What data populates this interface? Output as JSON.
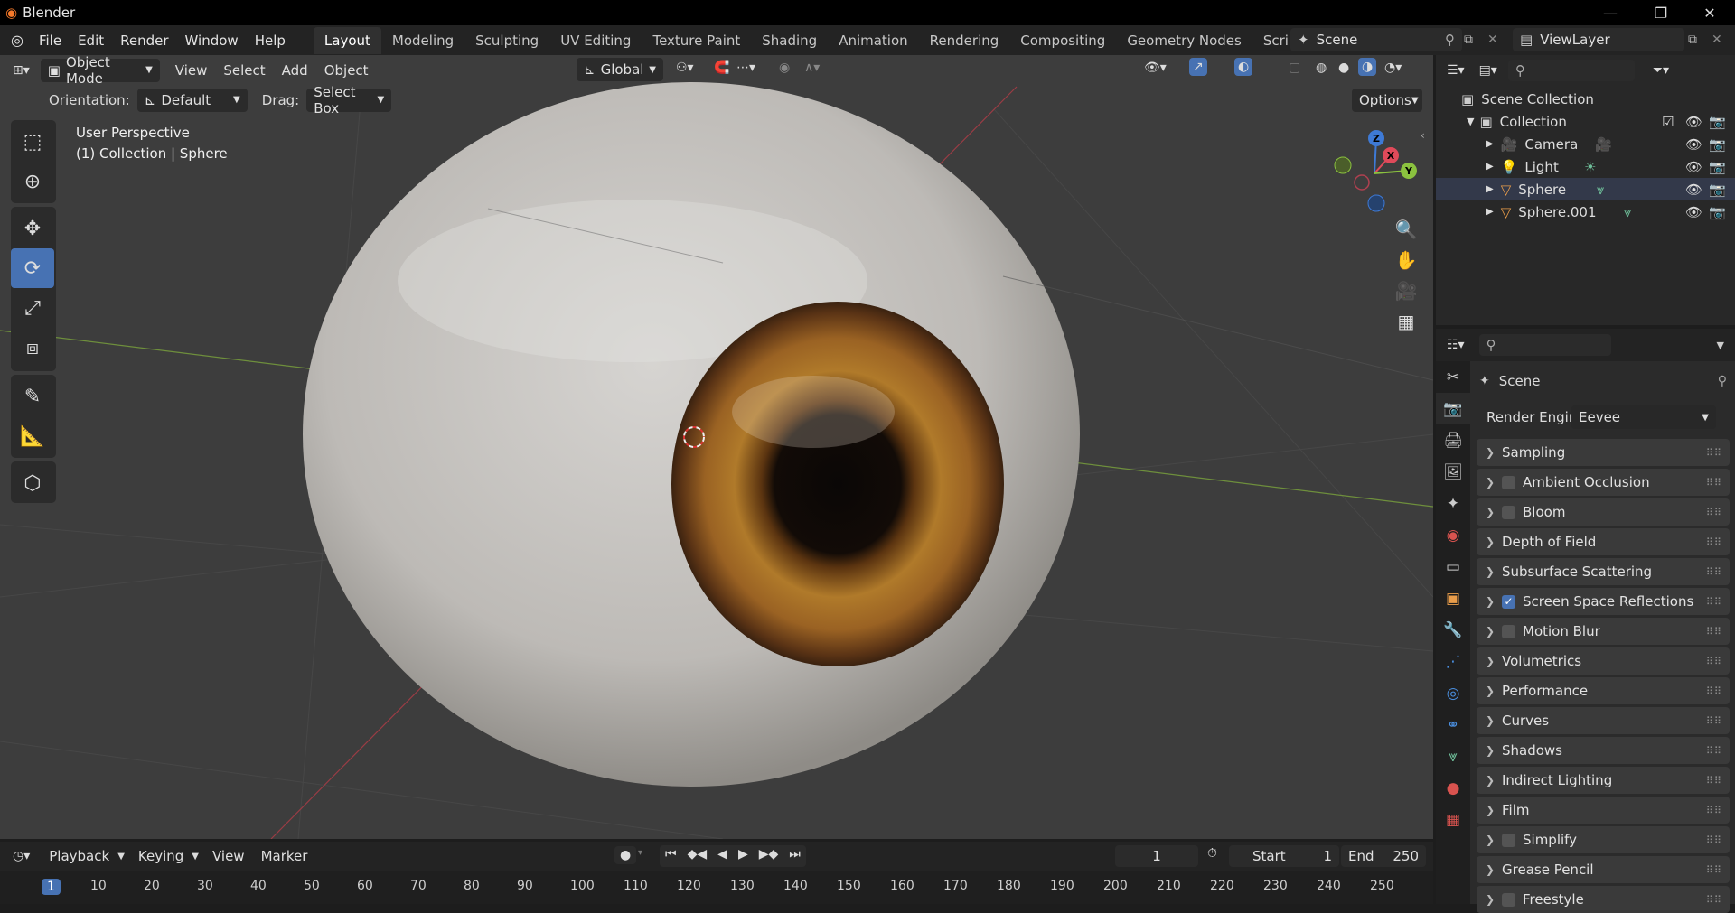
{
  "app": {
    "title": "Blender"
  },
  "menubar": {
    "items": [
      "File",
      "Edit",
      "Render",
      "Window",
      "Help"
    ]
  },
  "workspaces": {
    "tabs": [
      "Layout",
      "Modeling",
      "Sculpting",
      "UV Editing",
      "Texture Paint",
      "Shading",
      "Animation",
      "Rendering",
      "Compositing",
      "Geometry Nodes",
      "Scripting"
    ],
    "active": "Layout",
    "add_symbol": "+"
  },
  "scene": {
    "name": "Scene"
  },
  "view_layer": {
    "name": "ViewLayer"
  },
  "viewport": {
    "mode": "Object Mode",
    "menus": [
      "View",
      "Select",
      "Add",
      "Object"
    ],
    "transform_orientation": "Global",
    "orientation_label": "Orientation:",
    "orientation_value": "Default",
    "drag_label": "Drag:",
    "drag_value": "Select Box",
    "options_label": "Options",
    "overlay_text_line1": "User Perspective",
    "overlay_text_line2": "(1) Collection | Sphere",
    "gizmo_axes": {
      "x": "X",
      "y": "Y",
      "z": "Z"
    }
  },
  "outliner": {
    "root": "Scene Collection",
    "collection": "Collection",
    "items": [
      {
        "name": "Camera",
        "icon": "camera-icon"
      },
      {
        "name": "Light",
        "icon": "light-icon"
      },
      {
        "name": "Sphere",
        "icon": "mesh-icon"
      },
      {
        "name": "Sphere.001",
        "icon": "mesh-icon"
      }
    ]
  },
  "properties": {
    "context": "Scene",
    "render_engine_label": "Render Engine",
    "render_engine_value": "Eevee",
    "panels": [
      {
        "label": "Sampling",
        "checkbox": null
      },
      {
        "label": "Ambient Occlusion",
        "checkbox": false
      },
      {
        "label": "Bloom",
        "checkbox": false
      },
      {
        "label": "Depth of Field",
        "checkbox": null
      },
      {
        "label": "Subsurface Scattering",
        "checkbox": null
      },
      {
        "label": "Screen Space Reflections",
        "checkbox": true
      },
      {
        "label": "Motion Blur",
        "checkbox": false
      },
      {
        "label": "Volumetrics",
        "checkbox": null
      },
      {
        "label": "Performance",
        "checkbox": null
      },
      {
        "label": "Curves",
        "checkbox": null
      },
      {
        "label": "Shadows",
        "checkbox": null
      },
      {
        "label": "Indirect Lighting",
        "checkbox": null
      },
      {
        "label": "Film",
        "checkbox": null
      },
      {
        "label": "Simplify",
        "checkbox": false
      },
      {
        "label": "Grease Pencil",
        "checkbox": null
      },
      {
        "label": "Freestyle",
        "checkbox": false
      }
    ]
  },
  "timeline": {
    "menus": [
      "Playback",
      "Keying",
      "View",
      "Marker"
    ],
    "current_frame": "1",
    "start_label": "Start",
    "start_value": "1",
    "end_label": "End",
    "end_value": "250",
    "ruler": [
      "1",
      "10",
      "20",
      "30",
      "40",
      "50",
      "60",
      "70",
      "80",
      "90",
      "100",
      "110",
      "120",
      "130",
      "140",
      "150",
      "160",
      "170",
      "180",
      "190",
      "200",
      "210",
      "220",
      "230",
      "240",
      "250"
    ]
  },
  "colors": {
    "accent": "#4772b3",
    "x_axis": "#e04a5a",
    "y_axis": "#8bc23f",
    "z_axis": "#3e7ad6"
  }
}
